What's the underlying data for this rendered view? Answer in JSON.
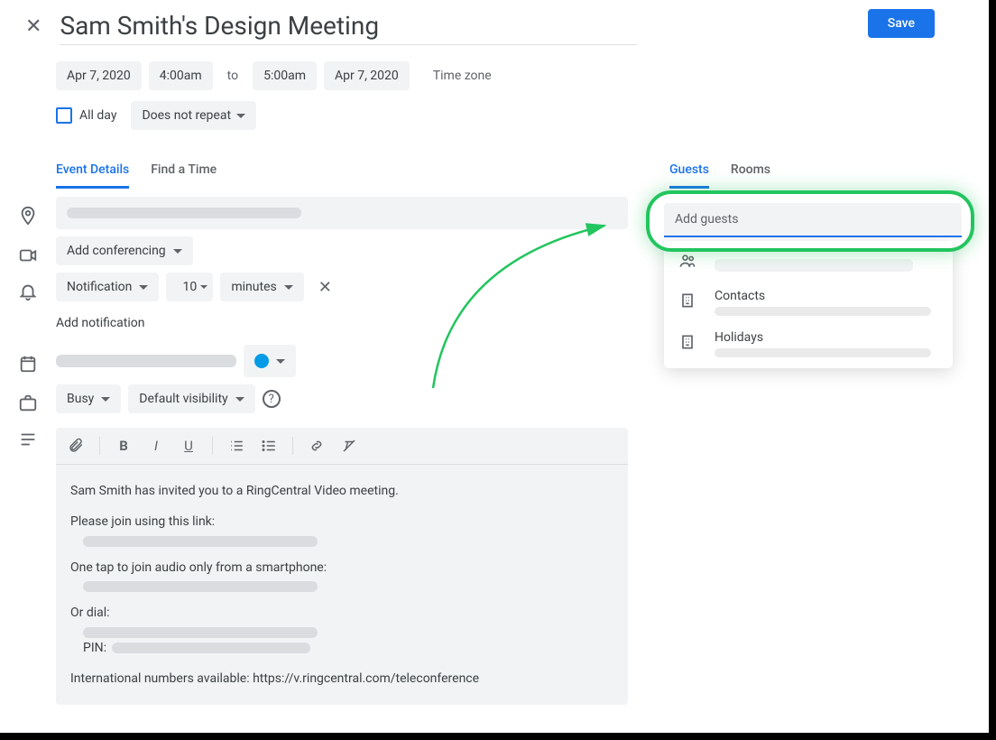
{
  "header": {
    "title": "Sam Smith's Design Meeting",
    "save_label": "Save"
  },
  "datetime": {
    "start_date": "Apr 7, 2020",
    "start_time": "4:00am",
    "to": "to",
    "end_time": "5:00am",
    "end_date": "Apr 7, 2020",
    "timezone_label": "Time zone"
  },
  "options": {
    "all_day_label": "All day",
    "repeat_label": "Does not repeat"
  },
  "tabs": {
    "left": [
      {
        "label": "Event Details",
        "active": true
      },
      {
        "label": "Find a Time",
        "active": false
      }
    ],
    "right": [
      {
        "label": "Guests",
        "active": true
      },
      {
        "label": "Rooms",
        "active": false
      }
    ]
  },
  "conferencing": {
    "label": "Add conferencing"
  },
  "notification": {
    "type_label": "Notification",
    "value": "10",
    "unit_label": "minutes"
  },
  "add_notification_label": "Add notification",
  "busy_label": "Busy",
  "visibility_label": "Default visibility",
  "description": {
    "line1": "Sam Smith has invited you to a RingCentral Video meeting.",
    "line2": "Please join using this link:",
    "line3": "One tap to join audio only from a smartphone:",
    "line4": "Or dial:",
    "pin_label": "PIN:",
    "line5": "International numbers available: https://v.ringcentral.com/teleconference"
  },
  "guests": {
    "placeholder": "Add guests",
    "suggestions": [
      {
        "icon": "group",
        "label": ""
      },
      {
        "icon": "building",
        "label": "Contacts"
      },
      {
        "icon": "building",
        "label": "Holidays"
      }
    ]
  }
}
